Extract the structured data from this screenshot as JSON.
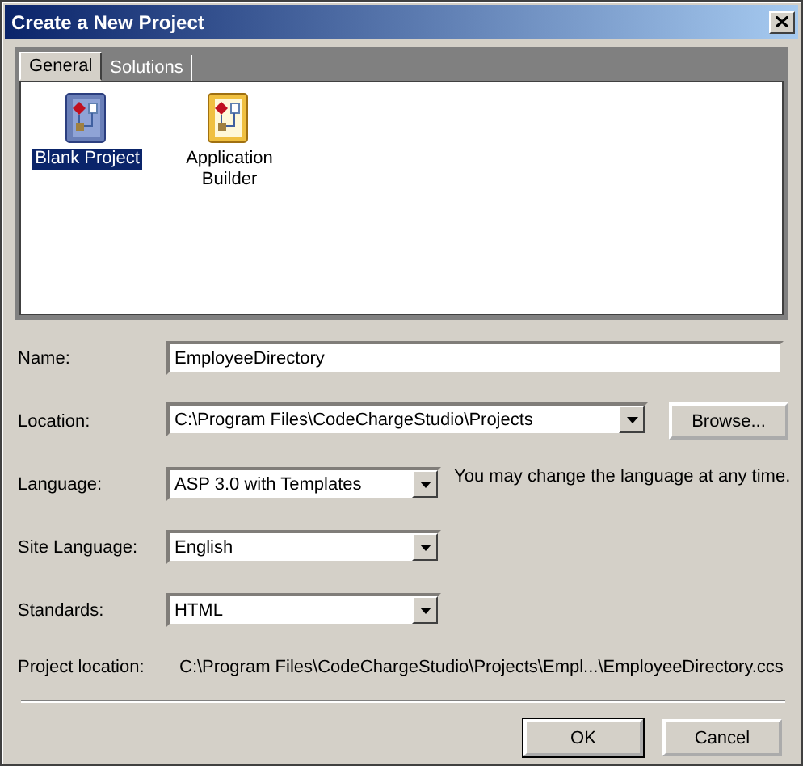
{
  "window": {
    "title": "Create a New Project"
  },
  "tabs": [
    {
      "label": "General",
      "selected": true
    },
    {
      "label": "Solutions",
      "selected": false
    }
  ],
  "templates": [
    {
      "label": "Blank Project",
      "selected": true
    },
    {
      "label": "Application Builder",
      "selected": false
    }
  ],
  "fields": [
    {
      "kind": "text",
      "label": "Name:",
      "value": "EmployeeDirectory"
    },
    {
      "kind": "combo",
      "label": "Location:",
      "value": "C:\\Program Files\\CodeChargeStudio\\Projects",
      "button": "Browse..."
    },
    {
      "kind": "combo",
      "label": "Language:",
      "value": "ASP 3.0 with Templates",
      "hint": "You may change the language at any time."
    },
    {
      "kind": "combo",
      "label": "Site Language:",
      "value": "English"
    },
    {
      "kind": "combo",
      "label": "Standards:",
      "value": "HTML"
    },
    {
      "kind": "static",
      "label": "Project location:",
      "value": "C:\\Program Files\\CodeChargeStudio\\Projects\\Empl...\\EmployeeDirectory.ccs"
    }
  ],
  "buttons": [
    {
      "label": "OK",
      "default": true
    },
    {
      "label": "Cancel",
      "default": false
    }
  ]
}
